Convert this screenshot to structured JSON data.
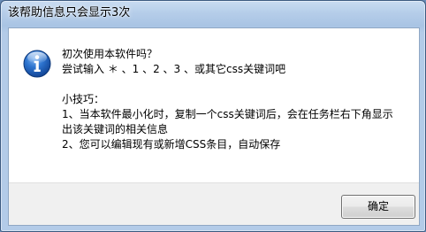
{
  "window": {
    "title": "该帮助信息只会显示3次"
  },
  "message": {
    "line1": "初次使用本软件吗？",
    "line2": "尝试输入 ＊ 、1 、2 、3 、或其它css关键词吧",
    "line3": "小技巧：",
    "line4": "1、当本软件最小化时，复制一个css关键词后，会在任务栏右下角显示",
    "line5": "出该关键词的相关信息",
    "line6": "2、您可以编辑现有或新增CSS条目，自动保存"
  },
  "buttons": {
    "ok_label": "确定"
  },
  "icon": {
    "name": "info-icon",
    "color": "#1c5fb8"
  }
}
